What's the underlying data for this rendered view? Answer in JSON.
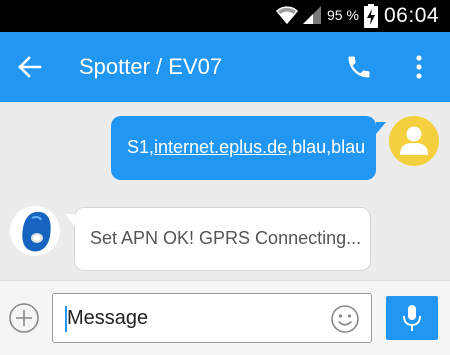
{
  "status_bar": {
    "battery_percent": "95 %",
    "time": "06:04",
    "icons": [
      "wifi-icon",
      "signal-icon",
      "battery-charging-icon"
    ]
  },
  "app_bar": {
    "title": "Spotter / EV07",
    "icons": [
      "back-arrow-icon",
      "phone-icon",
      "overflow-menu-icon"
    ],
    "color": "#2196f3"
  },
  "conversation": {
    "messages": [
      {
        "direction": "outgoing",
        "text_prefix": "S1,",
        "text_link": "internet.eplus.de",
        "text_suffix": ",blau,blau",
        "avatar_icon": "person-icon",
        "avatar_color": "#f4d03f"
      },
      {
        "direction": "incoming",
        "text": "Set APN OK! GPRS Connecting...",
        "avatar_icon": "gps-tracker-device-icon"
      }
    ],
    "background": "#ececec"
  },
  "composer": {
    "placeholder": "Message",
    "value": "",
    "icons": [
      "add-circle-icon",
      "emoji-icon",
      "microphone-icon"
    ]
  }
}
